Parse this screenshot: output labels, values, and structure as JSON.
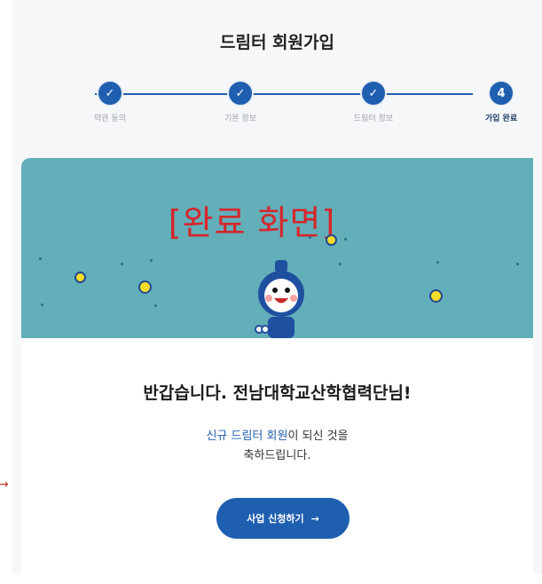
{
  "header": {
    "title": "드림터 회원가입"
  },
  "steps": [
    {
      "label": "약관 동의",
      "state": "done",
      "icon": "check-icon"
    },
    {
      "label": "기본 정보",
      "state": "done",
      "icon": "check-icon"
    },
    {
      "label": "드림터 정보",
      "state": "done",
      "icon": "check-icon"
    },
    {
      "label": "가입 완료",
      "state": "current",
      "number": "4"
    }
  ],
  "hero": {
    "label": "[완료 화면]"
  },
  "message": {
    "greeting": "반갑습니다. 전남대학교산학협력단님!",
    "line1_highlight": "신규 드림터 회원",
    "line1_rest": "이 되신 것을",
    "line2": "축하드립니다."
  },
  "cta": {
    "label": "사업 신청하기",
    "arrow": "→"
  },
  "colors": {
    "primary": "#1f5fb0",
    "hero_bg": "#62aeb9",
    "annotation_red": "#d6262b"
  }
}
